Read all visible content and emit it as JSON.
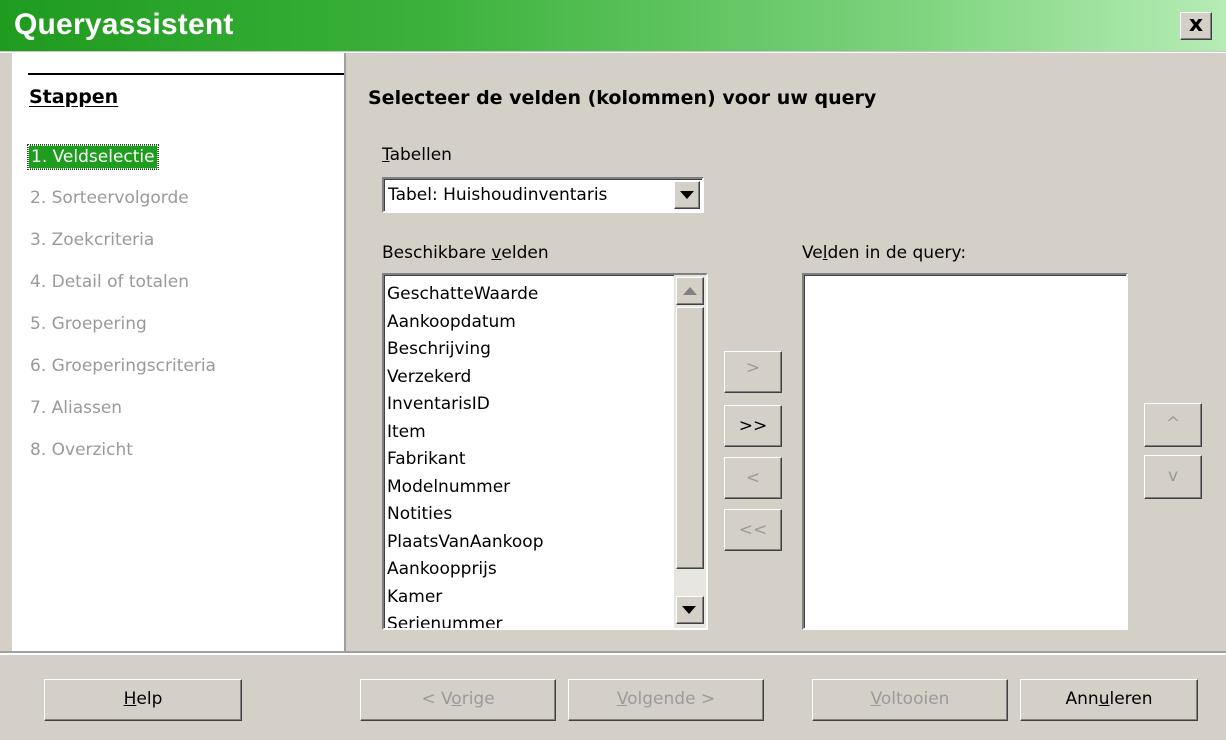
{
  "window": {
    "title": "Queryassistent",
    "close_glyph": "✕",
    "close_label": "x"
  },
  "sidebar": {
    "title": "Stappen",
    "steps": [
      "1. Veldselectie",
      "2. Sorteervolgorde",
      "3. Zoekcriteria",
      "4. Detail of totalen",
      "5. Groepering",
      "6. Groeperingscriteria",
      "7. Aliassen",
      "8. Overzicht"
    ],
    "active_step": 0
  },
  "main": {
    "heading": "Selecteer de velden (kolommen) voor uw query",
    "tables_label_u": "T",
    "tables_label_rest": "abellen",
    "table_select_value": "Tabel: Huishoudinventaris",
    "available_label_pre": "Beschikbare ",
    "available_label_u": "v",
    "available_label_post": "elden",
    "query_label_pre": "Ve",
    "query_label_u": "l",
    "query_label_post": "den in de query:",
    "available_fields": [
      "GeschatteWaarde",
      "Aankoopdatum",
      "Beschrijving",
      "Verzekerd",
      "InventarisID",
      "Item",
      "Fabrikant",
      "Modelnummer",
      "Notities",
      "PlaatsVanAankoop",
      "Aankoopprijs",
      "Kamer",
      "Serienummer"
    ],
    "query_fields": [],
    "move_buttons": {
      "add_one": ">",
      "add_all": ">>",
      "remove_one": "<",
      "remove_all": "<<"
    },
    "order_buttons": {
      "up": "^",
      "down": "v"
    }
  },
  "footer": {
    "help_u": "H",
    "help_rest": "elp",
    "back_pre": "< V",
    "back_u": "o",
    "back_post": "rige",
    "next_u": "V",
    "next_rest": "olgende >",
    "finish_u": "V",
    "finish_rest": "oltooien",
    "cancel_pre": "Ann",
    "cancel_u": "u",
    "cancel_post": "leren"
  },
  "colors": {
    "title_green": "#1f9b1f",
    "active_step_bg": "#1e9c1e",
    "dialog_gray": "#d4d0c8",
    "disabled_text": "#9a9a9a"
  },
  "icons": {
    "combo_arrow": "chevron-down-icon",
    "scroll_up": "scroll-up-icon",
    "scroll_down": "scroll-down-icon"
  }
}
